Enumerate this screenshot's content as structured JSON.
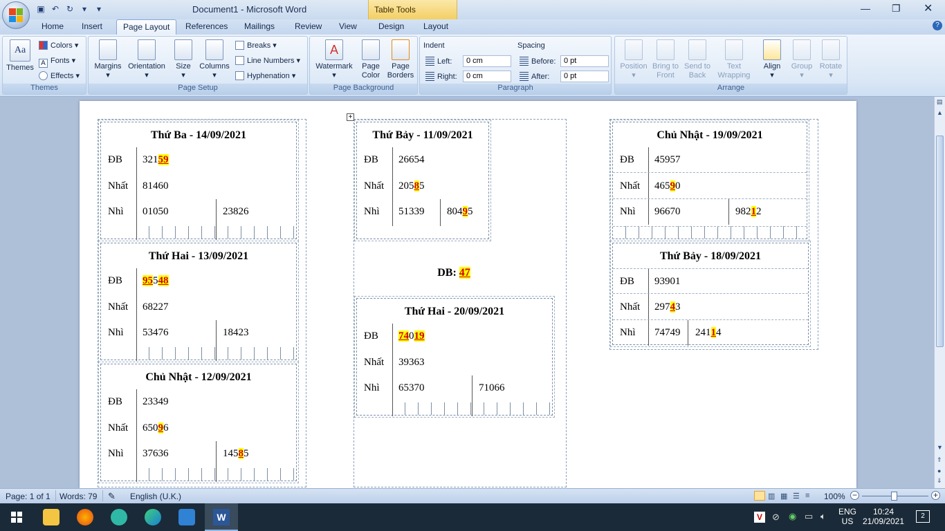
{
  "app": {
    "doc_title": "Document1 - Microsoft Word",
    "contextual_tab": "Table Tools"
  },
  "tabs": [
    "Home",
    "Insert",
    "Page Layout",
    "References",
    "Mailings",
    "Review",
    "View",
    "Design",
    "Layout"
  ],
  "ribbon": {
    "themes": {
      "label": "Themes",
      "themes_btn": "Themes",
      "colors": "Colors",
      "fonts": "Fonts",
      "effects": "Effects"
    },
    "page_setup": {
      "label": "Page Setup",
      "margins": "Margins",
      "orientation": "Orientation",
      "size": "Size",
      "columns": "Columns",
      "breaks": "Breaks",
      "line_numbers": "Line Numbers",
      "hyphenation": "Hyphenation"
    },
    "page_background": {
      "label": "Page Background",
      "watermark": "Watermark",
      "page_color_1": "Page",
      "page_color_2": "Color",
      "page_borders_1": "Page",
      "page_borders_2": "Borders"
    },
    "paragraph": {
      "label": "Paragraph",
      "indent": "Indent",
      "left": "Left:",
      "right": "Right:",
      "left_val": "0 cm",
      "right_val": "0 cm",
      "spacing": "Spacing",
      "before": "Before:",
      "after": "After:",
      "before_val": "0 pt",
      "after_val": "0 pt"
    },
    "arrange": {
      "label": "Arrange",
      "position": "Position",
      "bring_front_1": "Bring to",
      "bring_front_2": "Front",
      "send_back_1": "Send to",
      "send_back_2": "Back",
      "text_wrap_1": "Text",
      "text_wrap_2": "Wrapping",
      "align": "Align",
      "group": "Group",
      "rotate": "Rotate"
    }
  },
  "cards": {
    "c1": {
      "title": "Thứ Ba - 14/09/2021",
      "db_label": "ĐB",
      "db_a": "321",
      "db_b": "59",
      "nhat_label": "Nhất",
      "nhat": "81460",
      "nhi_label": "Nhì",
      "nhi1": "01050",
      "nhi2": "23826"
    },
    "c2": {
      "title": "Thứ Hai - 13/09/2021",
      "db_label": "ĐB",
      "db_a": "95",
      "db_b": "5",
      "db_c": "48",
      "nhat_label": "Nhất",
      "nhat": "68227",
      "nhi_label": "Nhì",
      "nhi1": "53476",
      "nhi2": "18423"
    },
    "c3": {
      "title": "Chủ Nhật - 12/09/2021",
      "db_label": "ĐB",
      "db": "23349",
      "nhat_label": "Nhất",
      "nhat_a": "650",
      "nhat_b": "9",
      "nhat_c": "6",
      "nhi_label": "Nhì",
      "nhi1": "37636",
      "nhi2_a": "145",
      "nhi2_b": "8",
      "nhi2_c": "5"
    },
    "c4": {
      "title": "Thứ Bảy - 11/09/2021",
      "db_label": "ĐB",
      "db": "26654",
      "nhat_label": "Nhất",
      "nhat_a": "205",
      "nhat_b": "8",
      "nhat_c": "5",
      "nhi_label": "Nhì",
      "nhi1": "51339",
      "nhi2_a": "804",
      "nhi2_b": "9",
      "nhi2_c": "5"
    },
    "center": {
      "label": "DB:",
      "value": "47"
    },
    "c5": {
      "title": "Thứ Hai - 20/09/2021",
      "db_label": "ĐB",
      "db_a": "74",
      "db_b": "0",
      "db_c": "19",
      "nhat_label": "Nhất",
      "nhat": "39363",
      "nhi_label": "Nhì",
      "nhi1": "65370",
      "nhi2": "71066"
    },
    "c6": {
      "title": "Chủ Nhật - 19/09/2021",
      "db_label": "ĐB",
      "db": "45957",
      "nhat_label": "Nhất",
      "nhat_a": "465",
      "nhat_b": "9",
      "nhat_c": "0",
      "nhi_label": "Nhì",
      "nhi1": "96670",
      "nhi2_a": "982",
      "nhi2_b": "1",
      "nhi2_c": "2"
    },
    "c7": {
      "title": "Thứ Bảy - 18/09/2021",
      "db_label": "ĐB",
      "db": "93901",
      "nhat_label": "Nhất",
      "nhat_a": "297",
      "nhat_b": "4",
      "nhat_c": "3",
      "nhi_label": "Nhì",
      "nhi1": "74749",
      "nhi2_a": "241",
      "nhi2_b": "1",
      "nhi2_c": "4"
    }
  },
  "status": {
    "page": "Page: 1 of 1",
    "words": "Words: 79",
    "language": "English (U.K.)",
    "zoom": "100%"
  },
  "taskbar": {
    "lang1": "ENG",
    "lang2": "US",
    "time": "10:24",
    "date": "21/09/2021",
    "notif": "2"
  }
}
